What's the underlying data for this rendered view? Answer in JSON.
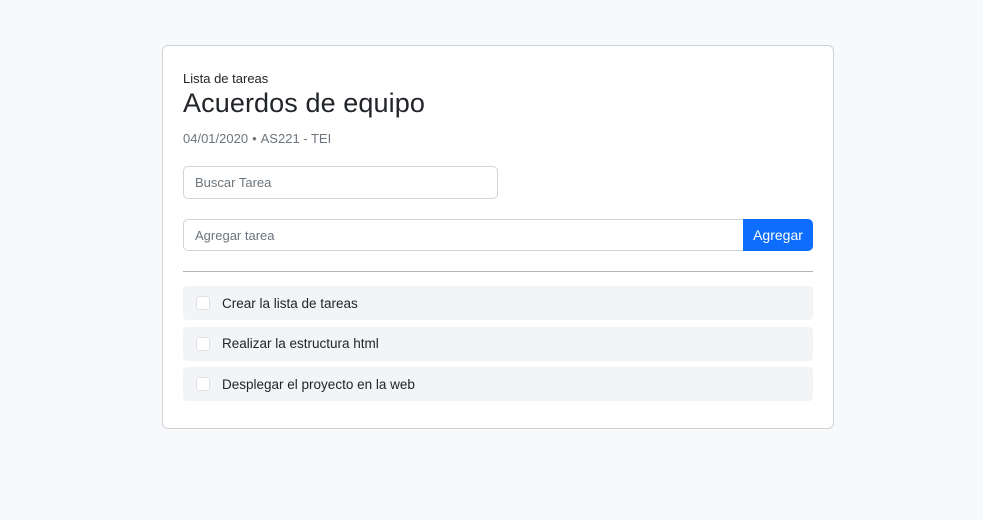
{
  "header": {
    "eyebrow": "Lista de tareas",
    "title": "Acuerdos de equipo",
    "date": "04/01/2020",
    "separator": "•",
    "course": "AS221 - TEI"
  },
  "search": {
    "placeholder": "Buscar Tarea"
  },
  "add_task": {
    "placeholder": "Agregar tarea",
    "button_label": "Agregar"
  },
  "tasks": [
    {
      "label": "Crear la lista de tareas",
      "checked": false
    },
    {
      "label": "Realizar la estructura html",
      "checked": false
    },
    {
      "label": "Desplegar el proyecto en la web",
      "checked": false
    }
  ],
  "colors": {
    "background": "#f8f9fa",
    "primary": "#0d6efd",
    "task_bg": "#f3f4f6"
  }
}
